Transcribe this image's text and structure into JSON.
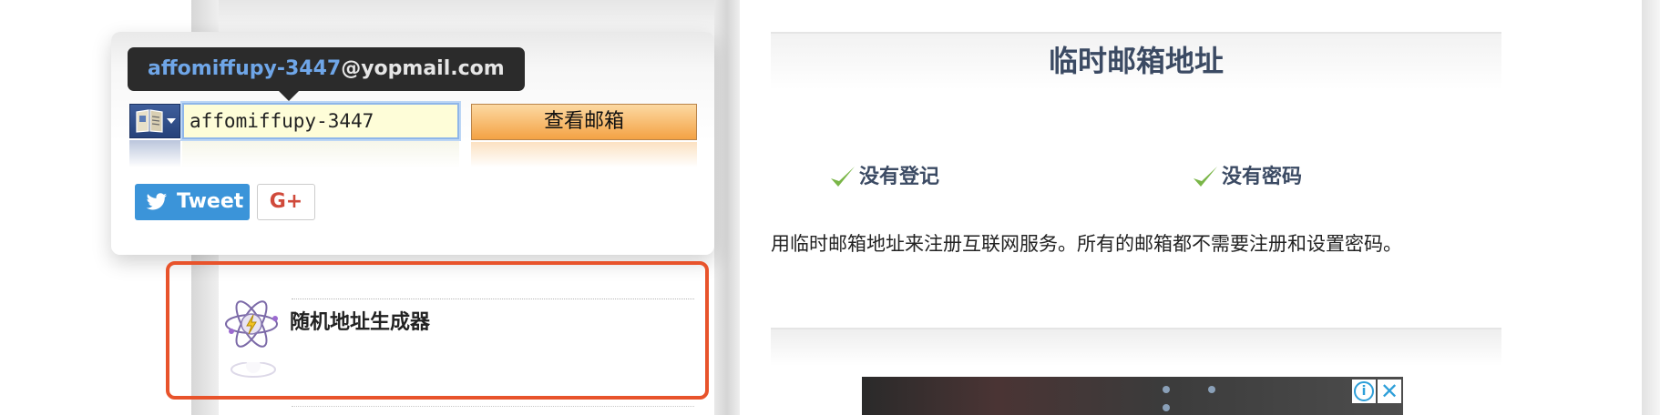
{
  "email_widget": {
    "tooltip_username": "affomiffupy-3447",
    "tooltip_domain": "@yopmail.com",
    "input_value": "affomiffupy-3447",
    "check_mail_label": "查看邮箱",
    "tweet_label": "Tweet",
    "gplus_label": "G+"
  },
  "generator": {
    "label": "随机地址生成器"
  },
  "main": {
    "title": "临时邮箱地址",
    "features": [
      {
        "label": "没有登记"
      },
      {
        "label": "没有密码"
      }
    ],
    "description": "用临时邮箱地址来注册互联网服务。所有的邮箱都不需要注册和设置密码。"
  },
  "ad": {
    "info_symbol": "i",
    "close_symbol": "✕"
  },
  "colors": {
    "highlight_border": "#e8532b",
    "title_text": "#3b4a63",
    "tooltip_username": "#6fa6e8",
    "button_orange": "#f4a244",
    "tweet_blue": "#3b94d9",
    "gplus_red": "#d04a3b",
    "check_green": "#7ab648"
  }
}
